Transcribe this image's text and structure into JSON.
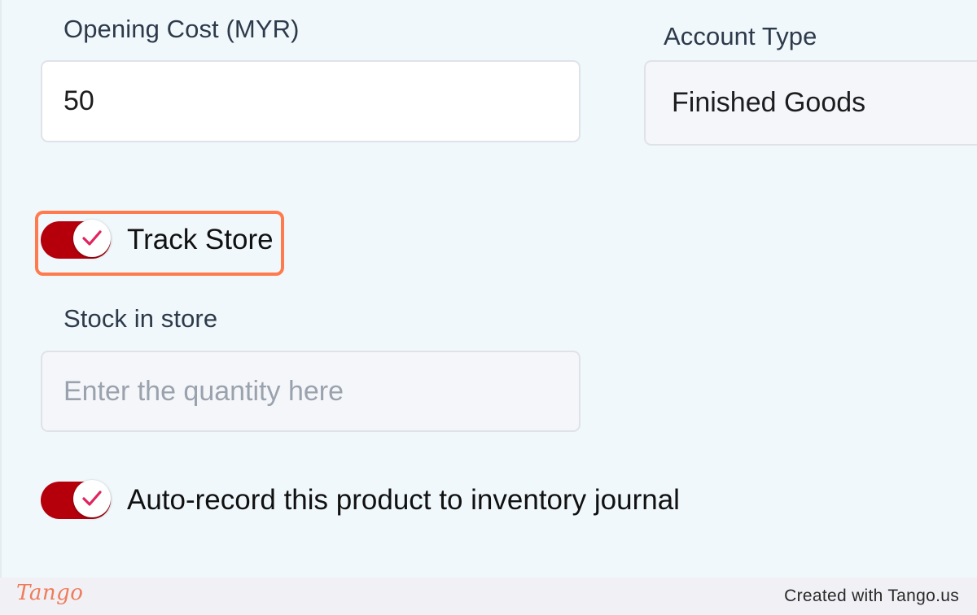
{
  "form": {
    "opening_cost": {
      "label": "Opening Cost (MYR)",
      "value": "50"
    },
    "account_type": {
      "label": "Account Type",
      "value": "Finished Goods"
    },
    "track_store": {
      "label": "Track Store",
      "checked": true
    },
    "stock_in_store": {
      "label": "Stock in store",
      "placeholder": "Enter the quantity here",
      "value": ""
    },
    "auto_record": {
      "label": "Auto-record this product to inventory journal",
      "checked": true
    }
  },
  "colors": {
    "toggle_on": "#b5000c",
    "check_mark": "#e0245e",
    "highlight": "#ff7b4d",
    "background": "#f0f8fc"
  },
  "icons": {
    "toggle_check": "check-icon",
    "brand": "tango-logo"
  },
  "footer": {
    "logo_text": "Tango",
    "credit": "Created with Tango.us"
  }
}
